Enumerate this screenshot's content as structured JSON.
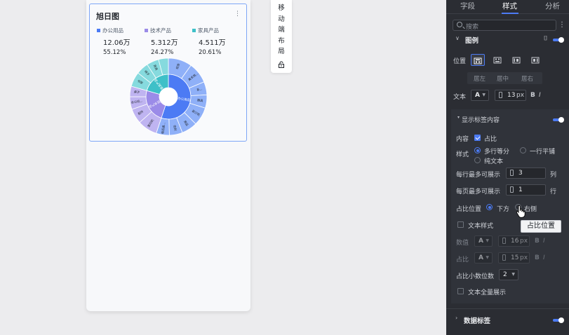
{
  "chart": {
    "title": "旭日图",
    "more": "⋮",
    "legend": [
      {
        "name": "办公用品",
        "value": "12.06万",
        "pct": "55.12%",
        "color": "#4c7bf4"
      },
      {
        "name": "技术产品",
        "value": "5.312万",
        "pct": "24.27%",
        "color": "#9b8be8"
      },
      {
        "name": "家具产品",
        "value": "4.511万",
        "pct": "20.61%",
        "color": "#3ec0c8"
      }
    ],
    "ring_labels": {
      "inner": [
        "办公用品",
        "技术产品",
        "家具产品"
      ],
      "outer": [
        "纸张",
        "美术用...",
        "系...",
        "器具",
        "装订机",
        "用品",
        "信封",
        "电话通...",
        "复印机",
        "配件",
        "办公机...",
        "桌子",
        "书架",
        "椅子",
        "用具"
      ]
    }
  },
  "chart_data": {
    "type": "sunburst",
    "title": "旭日图",
    "series": [
      {
        "name": "办公用品",
        "value": 120600,
        "pct": 55.12
      },
      {
        "name": "技术产品",
        "value": 53120,
        "pct": 24.27
      },
      {
        "name": "家具产品",
        "value": 45110,
        "pct": 20.61
      }
    ]
  },
  "float_tool": {
    "chars": [
      "移",
      "动",
      "端",
      "布",
      "局"
    ],
    "lock": "🔓"
  },
  "panel": {
    "tabs": [
      "字段",
      "样式",
      "分析"
    ],
    "active_tab": "样式",
    "search_placeholder": "搜索",
    "legend_section": "图例",
    "position_label": "位置",
    "align_options": [
      "居左",
      "居中",
      "居右"
    ],
    "text_label": "文本",
    "font_letter": "A",
    "font_size": "13",
    "unit_px": "px",
    "bold": "B",
    "italic": "I",
    "show_label_section": "显示标签内容",
    "content_label": "内容",
    "content_option": "占比",
    "style_label": "样式",
    "style_options": [
      "多行等分",
      "一行平铺",
      "纯文本"
    ],
    "per_row_label": "每行最多可展示",
    "per_row_value": "3",
    "per_row_unit": "列",
    "per_page_label": "每页最多可展示",
    "per_page_value": "1",
    "per_page_unit": "行",
    "pct_position_label": "占比位置",
    "pct_position_options": [
      "下方",
      "右侧"
    ],
    "text_style_label": "文本样式",
    "value_label": "数值",
    "value_size": "16",
    "pct_label": "占比",
    "pct_size": "15",
    "decimals_label": "占比小数位数",
    "decimals_value": "2",
    "full_text_label": "文本全量展示",
    "data_label_section": "数据标签",
    "tooltip": "占比位置"
  }
}
